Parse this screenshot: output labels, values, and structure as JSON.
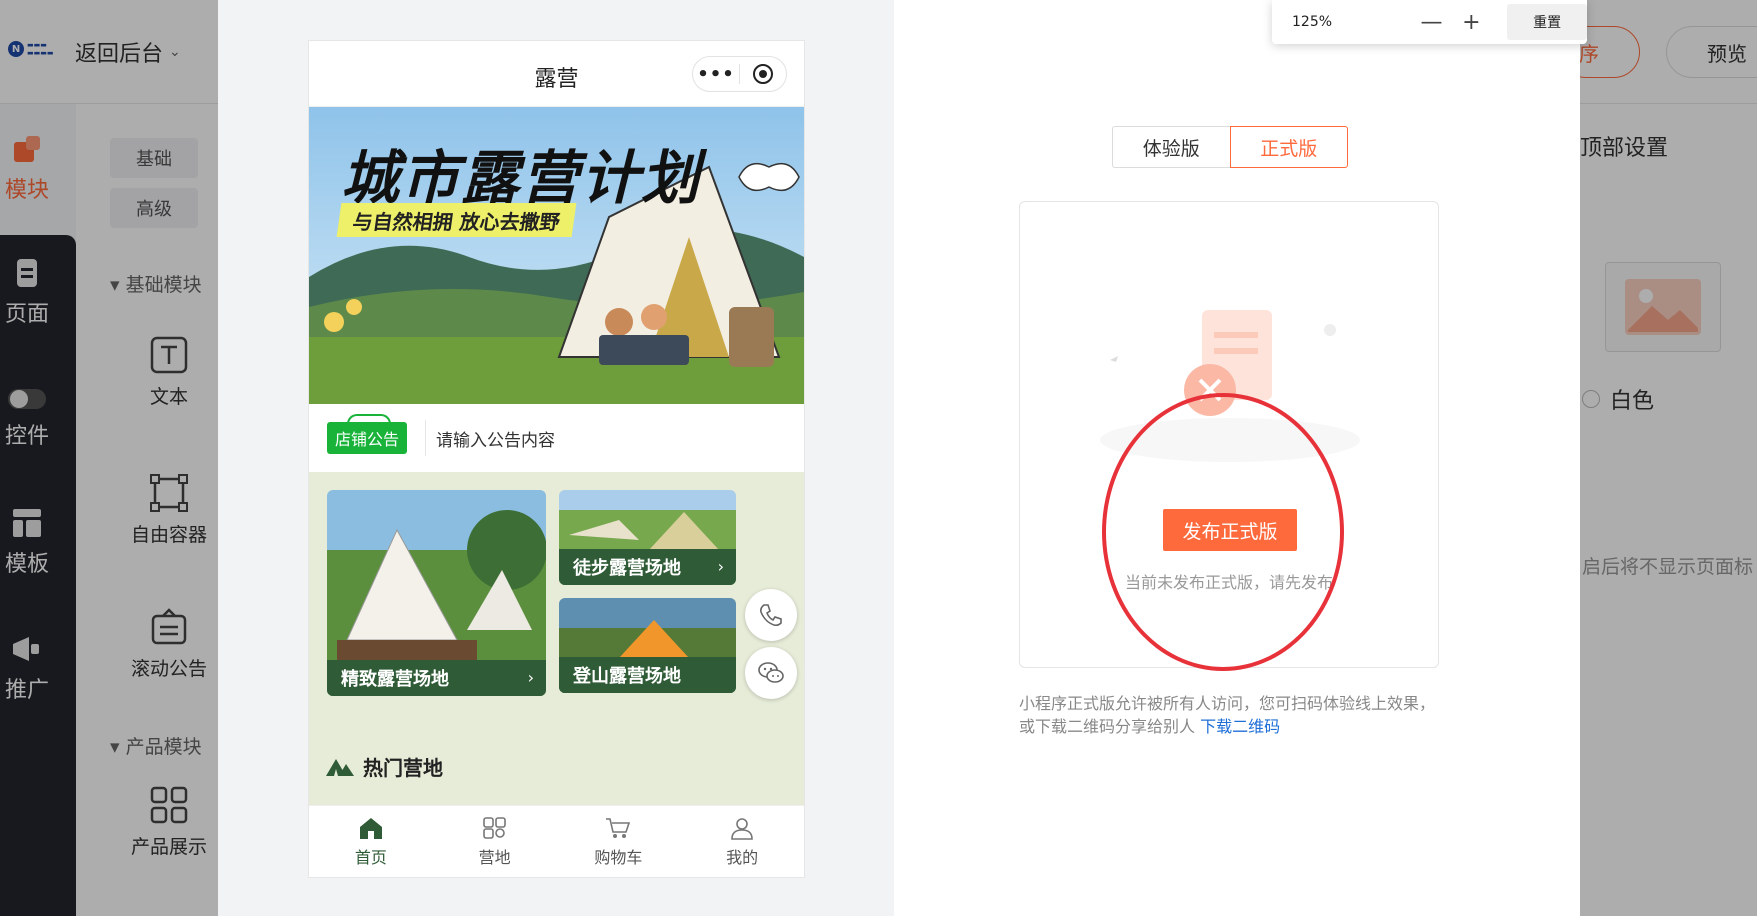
{
  "editor": {
    "back_label": "返回后台",
    "publish_label": "发布小程序",
    "publish_visible": "序",
    "preview_label": "预览",
    "nav": {
      "module": "模块",
      "page": "页面",
      "control": "控件",
      "template": "模板",
      "promote": "推广"
    },
    "tabs": {
      "basic": "基础",
      "advanced": "高级"
    },
    "groups": {
      "basic_modules": "基础模块",
      "product_modules": "产品模块"
    },
    "components": {
      "text": "文本",
      "free_container": "自由容器",
      "scroll_notice": "滚动公告",
      "product_display": "产品展示"
    },
    "right": {
      "title": "顶部设置",
      "white": "白色",
      "hint": "启后将不显示页面标"
    }
  },
  "phone": {
    "title": "露营",
    "banner": {
      "title": "城市露营计划",
      "subtitle": "与自然相拥 放心去撒野"
    },
    "notice": {
      "badge": "店铺公告",
      "text": "请输入公告内容"
    },
    "cards": [
      {
        "label": "精致露营场地"
      },
      {
        "label": "徒步露营场地"
      },
      {
        "label": "登山露营场地"
      }
    ],
    "section_title": "热门营地",
    "tabs": [
      "首页",
      "营地",
      "购物车",
      "我的"
    ]
  },
  "modal": {
    "segment": {
      "trial": "体验版",
      "release": "正式版"
    },
    "release_button": "发布正式版",
    "release_hint": "当前未发布正式版，请先发布",
    "desc": "小程序正式版允许被所有人访问，您可扫码体验线上效果，或下载二维码分享给别人",
    "download_link": "下载二维码"
  },
  "zoom": {
    "value": "125%",
    "reset": "重置"
  },
  "colors": {
    "accent": "#ff6a3d",
    "green": "#2f5b36",
    "ring": "#e8323a"
  }
}
